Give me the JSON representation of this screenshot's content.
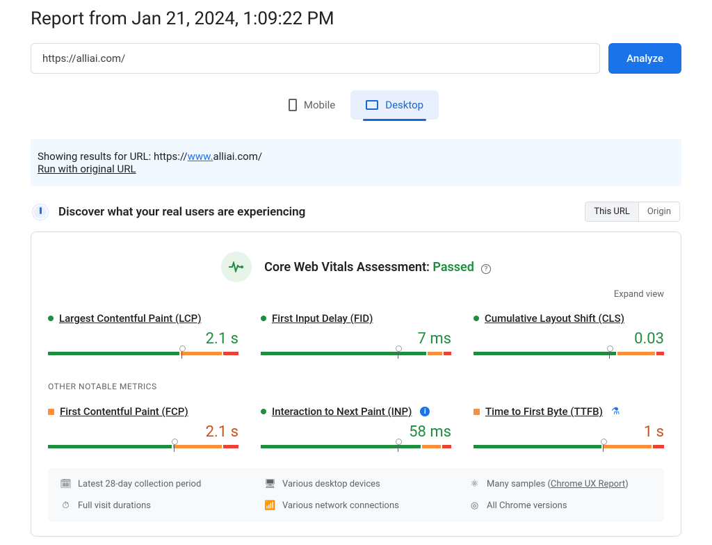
{
  "header": {
    "title": "Report from Jan 21, 2024, 1:09:22 PM",
    "url_value": "https://alliai.com/",
    "analyze_label": "Analyze"
  },
  "tabs": {
    "mobile": "Mobile",
    "desktop": "Desktop"
  },
  "notice": {
    "prefix": "Showing results for URL: https://",
    "www": "www.",
    "suffix": "alliai.com/",
    "run_original": "Run with original URL"
  },
  "discover": {
    "title": "Discover what your real users are experiencing",
    "this_url": "This URL",
    "origin": "Origin"
  },
  "assessment": {
    "label": "Core Web Vitals Assessment: ",
    "status": "Passed",
    "expand": "Expand view"
  },
  "metrics": {
    "lcp": {
      "name": "Largest Contentful Paint (LCP)",
      "value": "2.1 s"
    },
    "fid": {
      "name": "First Input Delay (FID)",
      "value": "7 ms"
    },
    "cls": {
      "name": "Cumulative Layout Shift (CLS)",
      "value": "0.03"
    },
    "other_label": "OTHER NOTABLE METRICS",
    "fcp": {
      "name": "First Contentful Paint (FCP)",
      "value": "2.1 s"
    },
    "inp": {
      "name": "Interaction to Next Paint (INP)",
      "value": "58 ms"
    },
    "ttfb": {
      "name": "Time to First Byte (TTFB)",
      "value": "1 s"
    }
  },
  "footer": {
    "period": "Latest 28-day collection period",
    "devices": "Various desktop devices",
    "samples_prefix": "Many samples (",
    "samples_link": "Chrome UX Report",
    "samples_suffix": ")",
    "durations": "Full visit durations",
    "network": "Various network connections",
    "chrome": "All Chrome versions"
  },
  "chart_data": [
    {
      "metric": "LCP",
      "value": "2.1 s",
      "status": "good",
      "marker_pct": 70,
      "segments": {
        "good": 70,
        "ni": 22,
        "poor": 8
      }
    },
    {
      "metric": "FID",
      "value": "7 ms",
      "status": "good",
      "marker_pct": 72,
      "segments": {
        "good": 88,
        "ni": 8,
        "poor": 4
      }
    },
    {
      "metric": "CLS",
      "value": "0.03",
      "status": "good",
      "marker_pct": 71,
      "segments": {
        "good": 76,
        "ni": 20,
        "poor": 4
      }
    },
    {
      "metric": "FCP",
      "value": "2.1 s",
      "status": "ni",
      "marker_pct": 66,
      "segments": {
        "good": 66,
        "ni": 26,
        "poor": 8
      }
    },
    {
      "metric": "INP",
      "value": "58 ms",
      "status": "good",
      "marker_pct": 72,
      "segments": {
        "good": 85,
        "ni": 10,
        "poor": 5
      }
    },
    {
      "metric": "TTFB",
      "value": "1 s",
      "status": "ni",
      "marker_pct": 68,
      "segments": {
        "good": 68,
        "ni": 26,
        "poor": 6
      }
    }
  ]
}
